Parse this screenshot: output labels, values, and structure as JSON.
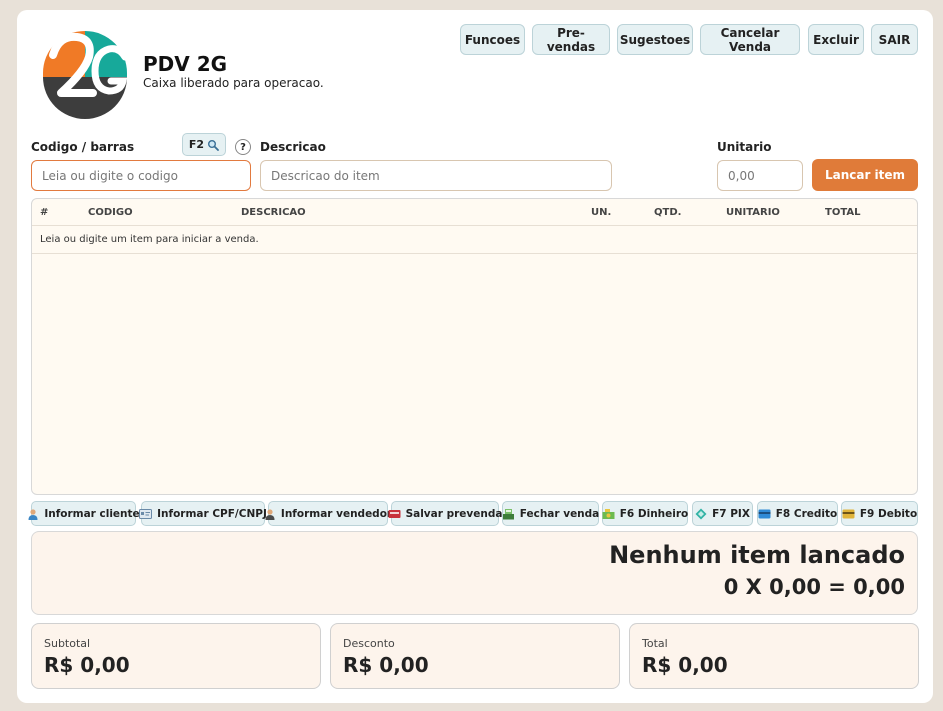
{
  "header": {
    "title": "PDV 2G",
    "status": "Caixa liberado para operacao.",
    "buttons": {
      "funcoes": "Funcoes",
      "prevendas": "Pre-vendas",
      "sugestoes": "Sugestoes",
      "cancelar": "Cancelar Venda",
      "excluir": "Excluir",
      "sair": "SAIR"
    }
  },
  "form": {
    "codigo_label": "Codigo / barras",
    "f2_label": "F2",
    "help_label": "?",
    "codigo_placeholder": "Leia ou digite o codigo",
    "descricao_label": "Descricao",
    "descricao_placeholder": "Descricao do item",
    "unitario_label": "Unitario",
    "unitario_placeholder": "0,00",
    "lancar_label": "Lancar item"
  },
  "table": {
    "columns": [
      "#",
      "CODIGO",
      "DESCRICAO",
      "UN.",
      "QTD.",
      "UNITARIO",
      "TOTAL"
    ],
    "empty_message": "Leia ou digite um item para iniciar a venda."
  },
  "actions": [
    {
      "label": "Informar cliente",
      "icon": "user-icon"
    },
    {
      "label": "Informar CPF/CNPJ",
      "icon": "id-card-icon"
    },
    {
      "label": "Informar vendedor",
      "icon": "seller-icon"
    },
    {
      "label": "Salvar prevenda",
      "icon": "save-icon"
    },
    {
      "label": "Fechar venda",
      "icon": "cash-register-icon"
    },
    {
      "label": "F6 Dinheiro",
      "icon": "money-icon"
    },
    {
      "label": "F7 PIX",
      "icon": "pix-icon"
    },
    {
      "label": "F8 Credito",
      "icon": "credit-card-icon"
    },
    {
      "label": "F9 Debito",
      "icon": "debit-card-icon"
    }
  ],
  "status": {
    "message": "Nenhum item lancado",
    "calc": "0 X 0,00 = 0,00"
  },
  "totals": {
    "subtotal_label": "Subtotal",
    "subtotal_value": "R$ 0,00",
    "desconto_label": "Desconto",
    "desconto_value": "R$ 0,00",
    "total_label": "Total",
    "total_value": "R$ 0,00"
  },
  "colors": {
    "accent": "#e07b39",
    "logo_teal": "#17a99a",
    "logo_orange": "#f07a26",
    "logo_dark": "#3d3d3d",
    "button_bg": "#e6f1f3"
  }
}
